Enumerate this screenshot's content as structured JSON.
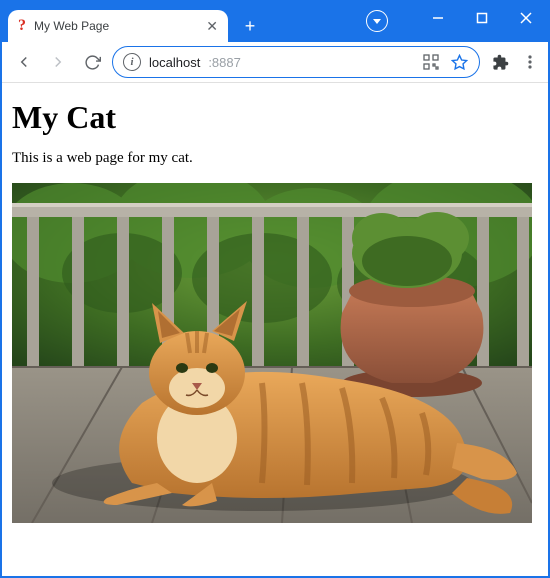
{
  "window": {
    "tab": {
      "favicon_glyph": "?",
      "title": "My Web Page"
    },
    "controls": {
      "minimize": "Minimize",
      "maximize": "Maximize",
      "close": "Close"
    }
  },
  "toolbar": {
    "back": "Back",
    "forward": "Forward",
    "reload": "Reload",
    "address": {
      "host": "localhost",
      "port": ":8887"
    },
    "qr_label": "Create QR code",
    "bookmark_label": "Bookmark this tab",
    "extensions_label": "Extensions",
    "menu_label": "Customize and control"
  },
  "page": {
    "heading": "My Cat",
    "paragraph": "This is a web page for my cat.",
    "image_alt": "Orange tabby cat lying on a wooden deck next to a terracotta planter with greenery behind a railing"
  }
}
